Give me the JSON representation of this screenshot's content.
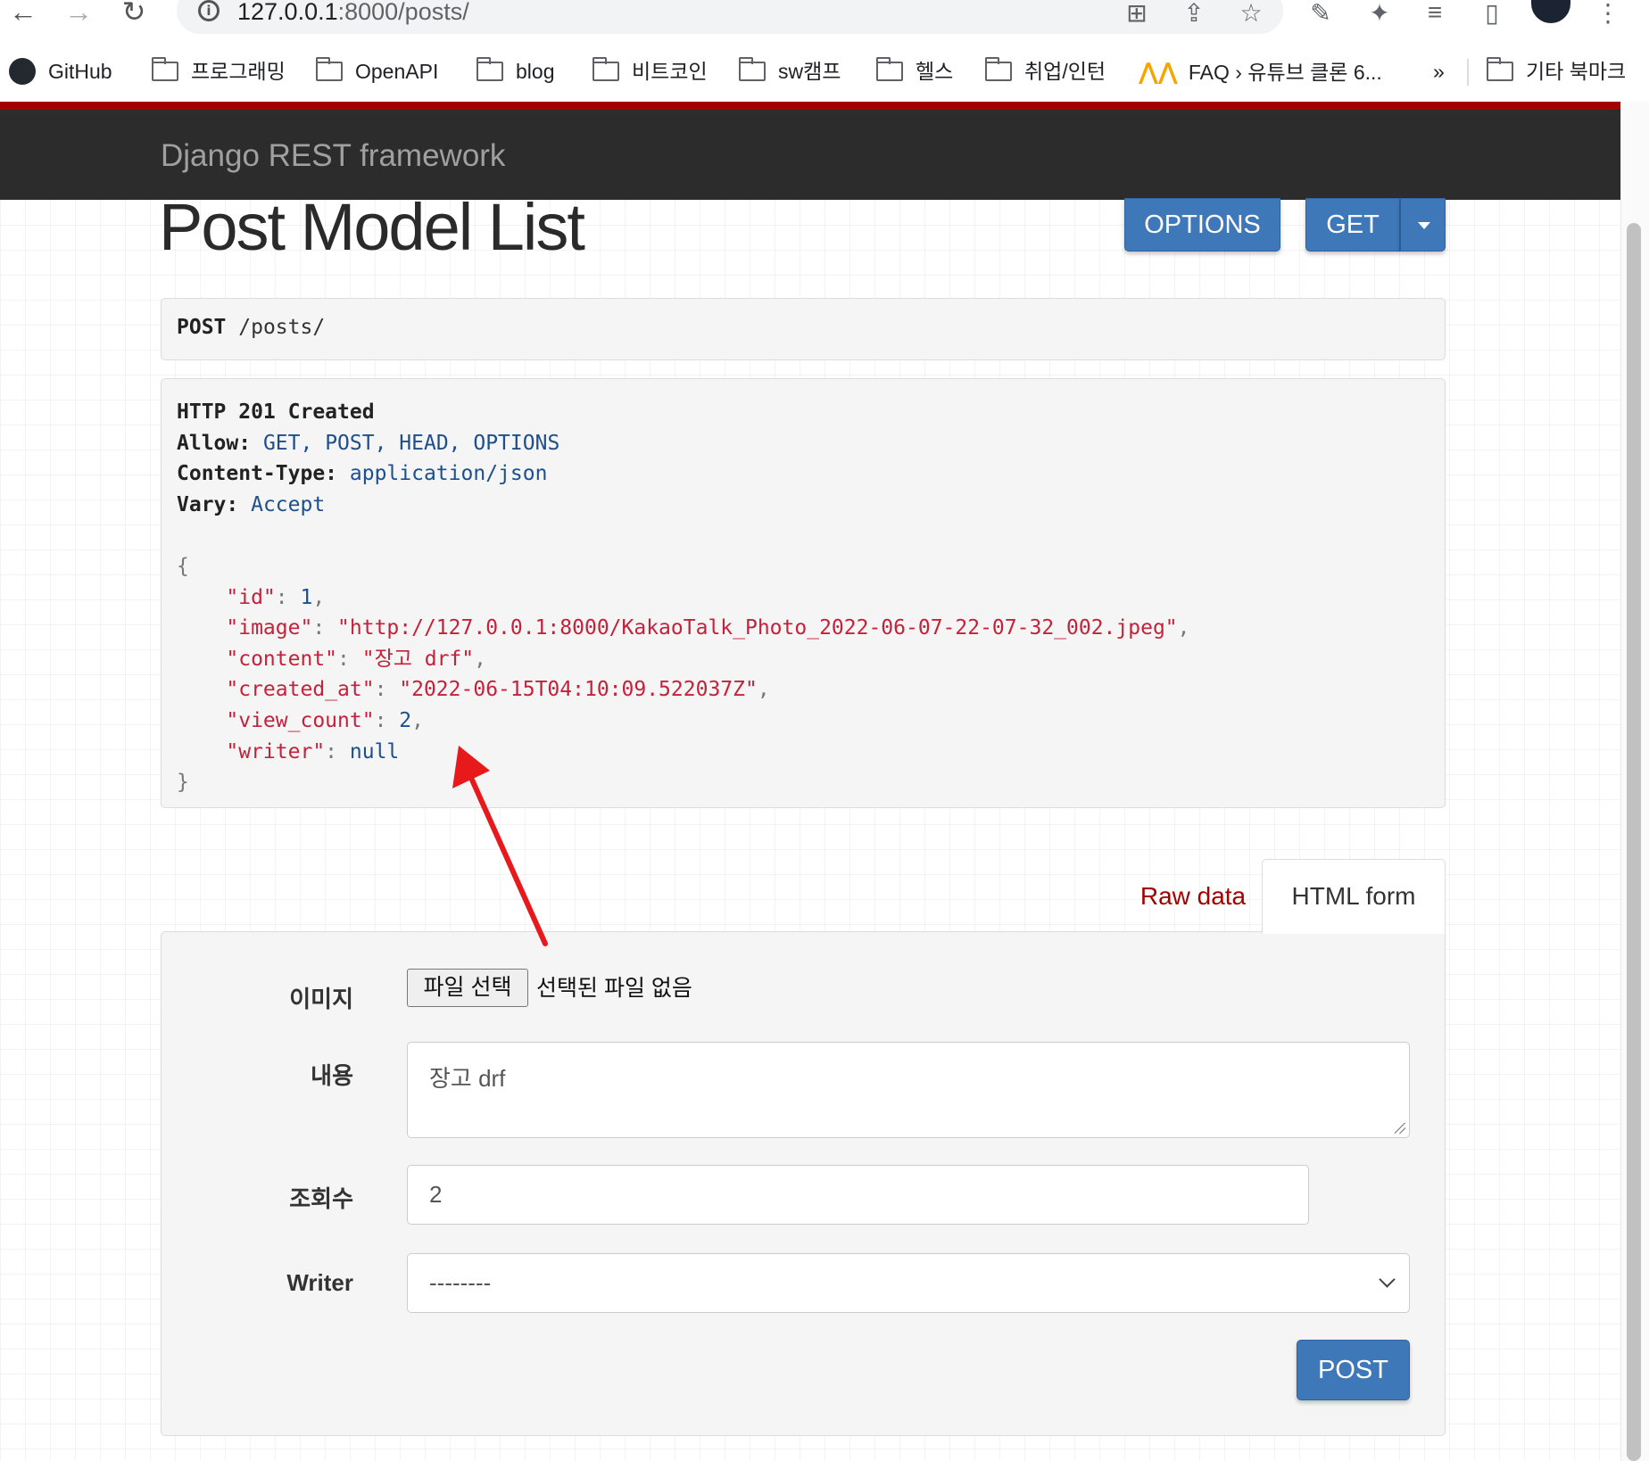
{
  "browser": {
    "url_host": "127.0.0.1",
    "url_path": ":8000/posts/",
    "bookmarks": [
      {
        "label": "GitHub",
        "icon": "github-icon"
      },
      {
        "label": "프로그래밍",
        "icon": "folder-icon"
      },
      {
        "label": "OpenAPI",
        "icon": "folder-icon"
      },
      {
        "label": "blog",
        "icon": "folder-icon"
      },
      {
        "label": "비트코인",
        "icon": "folder-icon"
      },
      {
        "label": "sw캠프",
        "icon": "folder-icon"
      },
      {
        "label": "헬스",
        "icon": "folder-icon"
      },
      {
        "label": "취업/인턴",
        "icon": "folder-icon"
      },
      {
        "label": "FAQ › 유튜브 클론 6...",
        "icon": "nomad-icon"
      },
      {
        "label": "»",
        "icon": "overflow-icon"
      },
      {
        "label": "기타 북마크",
        "icon": "folder-icon"
      }
    ]
  },
  "drf": {
    "brand": "Django REST framework",
    "page_title": "Post Model List",
    "buttons": {
      "options": "OPTIONS",
      "get": "GET",
      "post": "POST"
    },
    "request": {
      "method": "POST",
      "path": "/posts/"
    },
    "response": {
      "status": "HTTP 201 Created",
      "headers": [
        {
          "key": "Allow:",
          "value": "GET, POST, HEAD, OPTIONS"
        },
        {
          "key": "Content-Type:",
          "value": "application/json"
        },
        {
          "key": "Vary:",
          "value": "Accept"
        }
      ],
      "body": {
        "id": "1",
        "image": "\"http://127.0.0.1:8000/KakaoTalk_Photo_2022-06-07-22-07-32_002.jpeg\"",
        "content": "\"장고 drf\"",
        "created_at": "\"2022-06-15T04:10:09.522037Z\"",
        "view_count": "2",
        "writer": "null"
      }
    },
    "tabs": {
      "raw": "Raw data",
      "html": "HTML form"
    },
    "form": {
      "image_label": "이미지",
      "file_button": "파일 선택",
      "file_status": "선택된 파일 없음",
      "content_label": "내용",
      "content_value": "장고 drf",
      "view_count_label": "조회수",
      "view_count_value": "2",
      "writer_label": "Writer",
      "writer_value": "--------"
    }
  },
  "colors": {
    "navbar": "#2c2c2c",
    "accent_red": "#a30000",
    "button_blue": "#3f78b8",
    "annotation_arrow": "#e8191b"
  }
}
